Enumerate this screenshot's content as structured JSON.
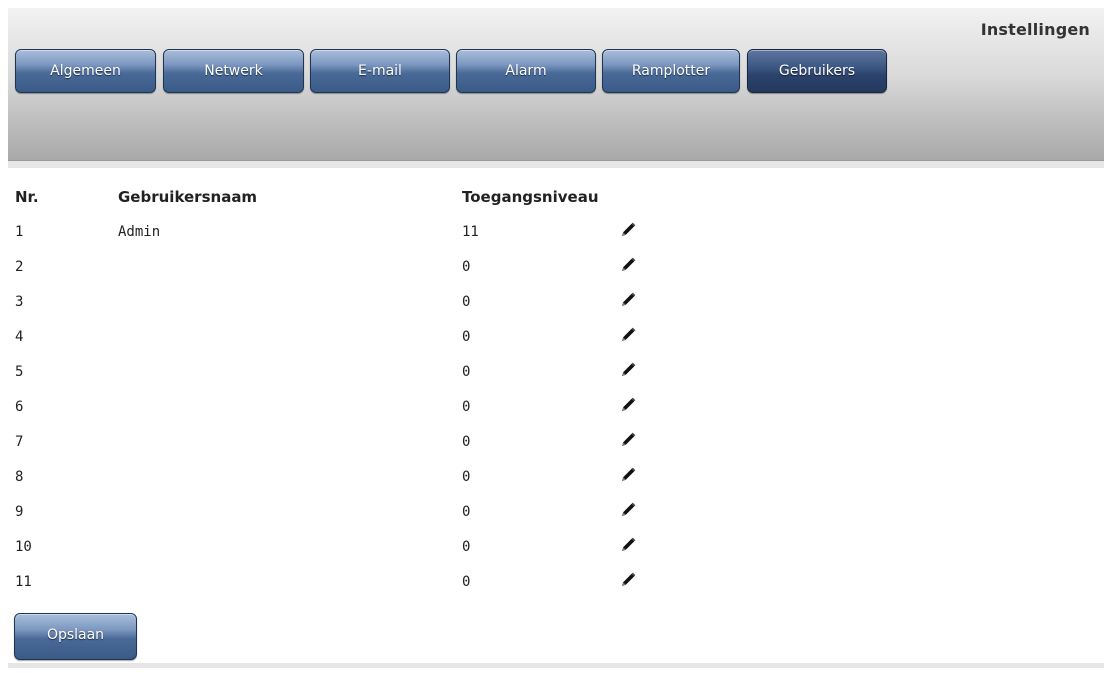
{
  "header": {
    "title": "Instellingen"
  },
  "tabs": [
    {
      "label": "Algemeen",
      "active": false
    },
    {
      "label": "Netwerk",
      "active": false
    },
    {
      "label": "E-mail",
      "active": false
    },
    {
      "label": "Alarm",
      "active": false
    },
    {
      "label": "Ramplotter",
      "active": false
    },
    {
      "label": "Gebruikers",
      "active": true
    }
  ],
  "table": {
    "headers": {
      "nr": "Nr.",
      "username": "Gebruikersnaam",
      "access_level": "Toegangsniveau"
    },
    "rows": [
      {
        "nr": "1",
        "username": "Admin",
        "access_level": "11"
      },
      {
        "nr": "2",
        "username": "",
        "access_level": "0"
      },
      {
        "nr": "3",
        "username": "",
        "access_level": "0"
      },
      {
        "nr": "4",
        "username": "",
        "access_level": "0"
      },
      {
        "nr": "5",
        "username": "",
        "access_level": "0"
      },
      {
        "nr": "6",
        "username": "",
        "access_level": "0"
      },
      {
        "nr": "7",
        "username": "",
        "access_level": "0"
      },
      {
        "nr": "8",
        "username": "",
        "access_level": "0"
      },
      {
        "nr": "9",
        "username": "",
        "access_level": "0"
      },
      {
        "nr": "10",
        "username": "",
        "access_level": "0"
      },
      {
        "nr": "11",
        "username": "",
        "access_level": "0"
      }
    ],
    "edit_icon": "pencil-icon"
  },
  "actions": {
    "save_label": "Opslaan"
  },
  "colors": {
    "button_blue": "#496a98",
    "button_active": "#2b426b",
    "header_gray": "#b9b9b9"
  }
}
